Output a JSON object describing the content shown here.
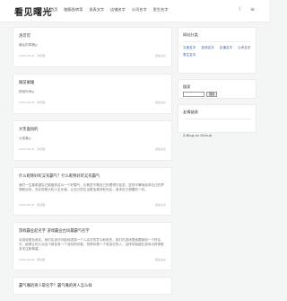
{
  "header": {
    "logo": "看见曙光",
    "nav": [
      "首页",
      "脑筋急转弯",
      "发表文字",
      "店铺名字",
      "公司名字",
      "男生名字"
    ],
    "icons": [
      "moon-icon",
      "menu-icon"
    ]
  },
  "posts": [
    {
      "title": "洛可可",
      "excerpt": "最后的草稿ღ",
      "date": "2020-09-30 · 浏览量",
      "more": "阅读全文"
    },
    {
      "title": "眼前阑珊",
      "excerpt": "那段时间ღ",
      "date": "2020-09-30 · 浏览量",
      "more": "阅读全文"
    },
    {
      "title": "大笑喜悦的",
      "excerpt": "大笑喜ღ",
      "date": "2020-09-30 · 浏览量",
      "more": "阅读全文"
    },
    {
      "title": "什么昵称好听又有霸气？什么昵称好听又有霸气",
      "excerpt": "我们一生都希望自己能做到这么一个好霸气，长期坚守着自己的理想与信念，坚持不懈地追求自己的梦想和目标，去实现更大的人生价值，让自己的生活更加美好和充实，追求自己想要的一切。",
      "date": "2020-09-30 · 阅读量",
      "more": "阅读全文"
    },
    {
      "title": "游戏霸业起名字 游戏霸业古风最霸气名字",
      "excerpt": "对游戏角色命名，我们应该尽可能地选择一个人名字的意义和来历，我们在游戏里面要使用一个好名字，能够让别人对这个角色有一个深刻的印象，觉得你是一个有品位的人，这样你就能在游戏中获得更多关注和尊重。",
      "date": "2020-09-30 · 阅读量",
      "more": "阅读全文"
    },
    {
      "title": "霸气嘴的男人取名字？霸气嘴的男人怎么样",
      "excerpt": "",
      "date": "",
      "more": ""
    }
  ],
  "sidebar": {
    "tag_title": "网站分类",
    "tags": [
      "文案名字",
      "游戏名字",
      "店铺名字",
      "公司名字",
      "男生名字"
    ],
    "search_title": "搜索",
    "search_button": "搜索",
    "friend_title": "友情链接",
    "friend_link": "Z-Blog on Github"
  }
}
